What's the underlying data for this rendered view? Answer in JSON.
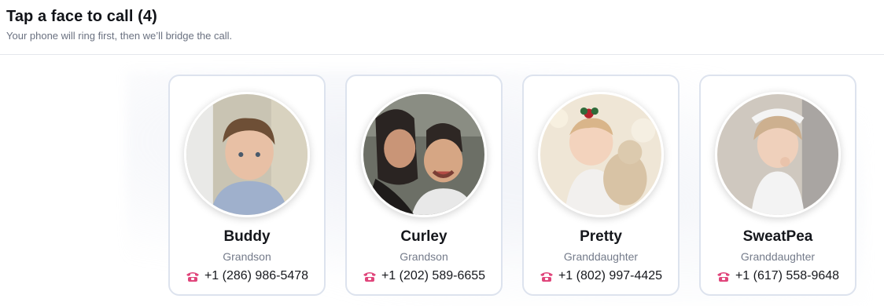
{
  "header": {
    "title": "Tap a face to call (4)",
    "subtitle": "Your phone will ring first, then we’ll bridge the call."
  },
  "contacts": [
    {
      "name": "Buddy",
      "relation": "Grandson",
      "phone": "+1 (286) 986-5478"
    },
    {
      "name": "Curley",
      "relation": "Grandson",
      "phone": "+1 (202) 589-6655"
    },
    {
      "name": "Pretty",
      "relation": "Granddaughter",
      "phone": "+1 (802) 997-4425"
    },
    {
      "name": "SweatPea",
      "relation": "Granddaughter",
      "phone": "+1 (617) 558-9648"
    }
  ],
  "icons": {
    "phone": "telephone-icon"
  },
  "colors": {
    "phone_icon": "#e0457b",
    "card_border": "#dde3ee"
  }
}
